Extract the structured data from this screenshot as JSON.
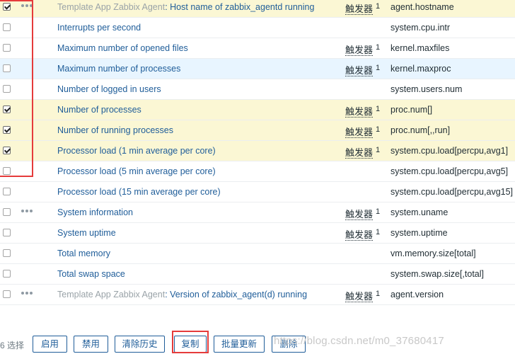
{
  "rows": [
    {
      "template": "Template App Zabbix Agent",
      "sep": ": ",
      "name": "Host name of zabbix_agentd running",
      "trigger_label": "触发器",
      "trigger_count": "1",
      "key": "agent.hostname",
      "checked": true,
      "dots": true
    },
    {
      "template": "",
      "sep": "",
      "name": "Interrupts per second",
      "trigger_label": "",
      "trigger_count": "",
      "key": "system.cpu.intr",
      "checked": false,
      "dots": false
    },
    {
      "template": "",
      "sep": "",
      "name": "Maximum number of opened files",
      "trigger_label": "触发器",
      "trigger_count": "1",
      "key": "kernel.maxfiles",
      "checked": false,
      "dots": false
    },
    {
      "template": "",
      "sep": "",
      "name": "Maximum number of processes",
      "trigger_label": "触发器",
      "trigger_count": "1",
      "key": "kernel.maxproc",
      "checked": false,
      "dots": false
    },
    {
      "template": "",
      "sep": "",
      "name": "Number of logged in users",
      "trigger_label": "",
      "trigger_count": "",
      "key": "system.users.num",
      "checked": false,
      "dots": false
    },
    {
      "template": "",
      "sep": "",
      "name": "Number of processes",
      "trigger_label": "触发器",
      "trigger_count": "1",
      "key": "proc.num[]",
      "checked": true,
      "dots": false
    },
    {
      "template": "",
      "sep": "",
      "name": "Number of running processes",
      "trigger_label": "触发器",
      "trigger_count": "1",
      "key": "proc.num[,,run]",
      "checked": true,
      "dots": false
    },
    {
      "template": "",
      "sep": "",
      "name": "Processor load (1 min average per core)",
      "trigger_label": "触发器",
      "trigger_count": "1",
      "key": "system.cpu.load[percpu,avg1]",
      "checked": true,
      "dots": false
    },
    {
      "template": "",
      "sep": "",
      "name": "Processor load (5 min average per core)",
      "trigger_label": "",
      "trigger_count": "",
      "key": "system.cpu.load[percpu,avg5]",
      "checked": false,
      "dots": false
    },
    {
      "template": "",
      "sep": "",
      "name": "Processor load (15 min average per core)",
      "trigger_label": "",
      "trigger_count": "",
      "key": "system.cpu.load[percpu,avg15]",
      "checked": false,
      "dots": false
    },
    {
      "template": "",
      "sep": "",
      "name": "System information",
      "trigger_label": "触发器",
      "trigger_count": "1",
      "key": "system.uname",
      "checked": false,
      "dots": true
    },
    {
      "template": "",
      "sep": "",
      "name": "System uptime",
      "trigger_label": "触发器",
      "trigger_count": "1",
      "key": "system.uptime",
      "checked": false,
      "dots": false
    },
    {
      "template": "",
      "sep": "",
      "name": "Total memory",
      "trigger_label": "",
      "trigger_count": "",
      "key": "vm.memory.size[total]",
      "checked": false,
      "dots": false
    },
    {
      "template": "",
      "sep": "",
      "name": "Total swap space",
      "trigger_label": "",
      "trigger_count": "",
      "key": "system.swap.size[,total]",
      "checked": false,
      "dots": false
    },
    {
      "template": "Template App Zabbix Agent",
      "sep": ": ",
      "name": "Version of zabbix_agent(d) running",
      "trigger_label": "触发器",
      "trigger_count": "1",
      "key": "agent.version",
      "checked": false,
      "dots": true
    }
  ],
  "footer": {
    "selected_count": "6 选择",
    "buttons": {
      "enable": "启用",
      "disable": "禁用",
      "clear_history": "清除历史",
      "copy": "复制",
      "mass_update": "批量更新",
      "delete": "删除"
    },
    "watermark": "https://blog.csdn.net/m0_37680417"
  },
  "colors": {
    "selected_row": "#fbf7d4",
    "hover_row": "#e8f5ff",
    "link": "#1f5d99",
    "annotation_red": "#e53b3b"
  },
  "icons": {
    "checkbox": "checkbox-icon",
    "more": "ellipsis-icon"
  }
}
